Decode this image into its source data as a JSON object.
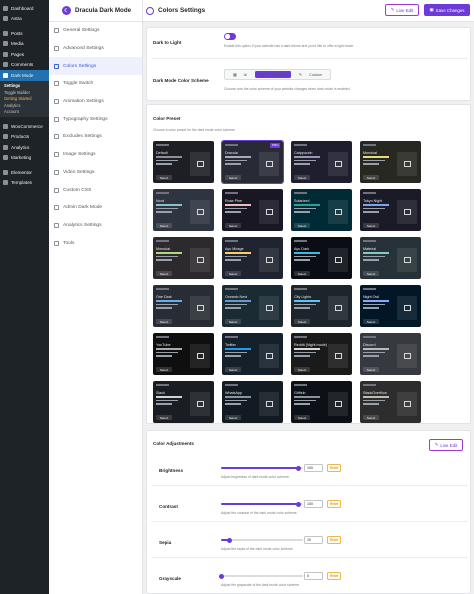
{
  "wp_menu": {
    "items_top": [
      {
        "label": "Dashboard",
        "icon": "dashboard-icon"
      },
      {
        "label": "Astra",
        "icon": "astra-icon"
      }
    ],
    "items_mid": [
      {
        "label": "Posts",
        "icon": "pin-icon"
      },
      {
        "label": "Media",
        "icon": "media-icon"
      },
      {
        "label": "Pages",
        "icon": "page-icon"
      },
      {
        "label": "Comments",
        "icon": "comment-icon"
      }
    ],
    "dark_mode": {
      "label": "Dark Mode",
      "icon": "moon-icon"
    },
    "submenu": [
      "Settings",
      "Toggle Builder",
      "Getting Started",
      "Analytics",
      "Account"
    ],
    "items_bottom": [
      {
        "label": "WooCommerce",
        "icon": "woo-icon"
      },
      {
        "label": "Products",
        "icon": "products-icon"
      },
      {
        "label": "Analytics",
        "icon": "analytics-icon"
      },
      {
        "label": "Marketing",
        "icon": "marketing-icon"
      }
    ],
    "items_last": [
      {
        "label": "Elementor",
        "icon": "elementor-icon"
      },
      {
        "label": "Templates",
        "icon": "templates-icon"
      }
    ]
  },
  "plugin": {
    "brand": "Dracula Dark Mode",
    "nav": [
      "General Settings",
      "Advanced Settings",
      "Colors Settings",
      "Toggle Switch",
      "Animation Settings",
      "Typography Settings",
      "Excludes Settings",
      "Image Settings",
      "Video Settings",
      "Custom CSS",
      "Admin Dark Mode",
      "Analytics Settings",
      "Tools"
    ],
    "active_nav": "Colors Settings"
  },
  "header": {
    "title": "Colors Settings",
    "live_edit": "Live Edit",
    "save": "Save Changes"
  },
  "settings": {
    "dark_to_light": {
      "label": "Dark to Light",
      "enabled": true,
      "desc": "Enable this option if your website has a dark theme and you'd like to offer a light mode."
    },
    "color_scheme": {
      "label": "Dark Mode Color Scheme",
      "options": [
        "AI",
        "Presets",
        "Custom"
      ],
      "selected": "Presets",
      "desc": "Choose how the color scheme of your website changes when dark mode is enabled."
    }
  },
  "color_preset": {
    "title": "Color Preset",
    "desc": "Choose a color preset for the dark mode color scheme.",
    "select_label": "Select",
    "pro_label": "PRO",
    "presets": [
      {
        "name": "Default",
        "bg": "#1e1f25",
        "bar": "#8a8f99"
      },
      {
        "name": "Dracula",
        "bg": "#282a36",
        "bar": "#a9abbd",
        "selected": true,
        "pro": true
      },
      {
        "name": "Catppuccin",
        "bg": "#1e1e2e",
        "bar": "#9399b2"
      },
      {
        "name": "Monokai",
        "bg": "#272822",
        "bar": "#e6db74"
      },
      {
        "name": "Nord",
        "bg": "#2e3440",
        "bar": "#88c0d0"
      },
      {
        "name": "Rose Pine",
        "bg": "#191724",
        "bar": "#ebbcba"
      },
      {
        "name": "Solarized",
        "bg": "#002b36",
        "bar": "#2aa198"
      },
      {
        "name": "Tokyo Night",
        "bg": "#1a1b26",
        "bar": "#7aa2f7"
      },
      {
        "name": "Monokai",
        "bg": "#2d2a2e",
        "bar": "#a9dc76"
      },
      {
        "name": "Ayu Mirage",
        "bg": "#1f2430",
        "bar": "#ffcc66"
      },
      {
        "name": "Ayu Dark",
        "bg": "#0a0e14",
        "bar": "#39bae6"
      },
      {
        "name": "Material",
        "bg": "#263238",
        "bar": "#80cbc4"
      },
      {
        "name": "One Dark",
        "bg": "#282c34",
        "bar": "#61afef"
      },
      {
        "name": "Oceanic Next",
        "bg": "#1b2b34",
        "bar": "#6699cc"
      },
      {
        "name": "City Lights",
        "bg": "#1d252c",
        "bar": "#5ec4ff"
      },
      {
        "name": "Night Owl",
        "bg": "#011627",
        "bar": "#82aaff"
      },
      {
        "name": "YouTube",
        "bg": "#0f0f0f",
        "bar": "#aaaaaa"
      },
      {
        "name": "Twitter",
        "bg": "#15202b",
        "bar": "#1d9bf0"
      },
      {
        "name": "Reddit (Night mode)",
        "bg": "#1a1a1b",
        "bar": "#d7dadc"
      },
      {
        "name": "Discord",
        "bg": "#36393f",
        "bar": "#b9bbbe"
      },
      {
        "name": "Slack",
        "bg": "#1a1d21",
        "bar": "#d1d2d3"
      },
      {
        "name": "WhatsApp",
        "bg": "#111b21",
        "bar": "#8696a0"
      },
      {
        "name": "GitHub",
        "bg": "#0d1117",
        "bar": "#8b949e"
      },
      {
        "name": "StackOverflow",
        "bg": "#2d2d2d",
        "bar": "#bbbbbb"
      }
    ]
  },
  "color_adjustments": {
    "title": "Color Adjustments",
    "live_edit": "Live Edit",
    "reset_label": "Reset",
    "items": [
      {
        "label": "Brightness",
        "value": "100",
        "fill": 0.95,
        "desc": "Adjust brightness of dark mode color scheme."
      },
      {
        "label": "Contrast",
        "value": "100",
        "fill": 0.95,
        "desc": "Adjust the contrast of the dark mode color scheme."
      },
      {
        "label": "Sepia",
        "value": "10",
        "fill": 0.1,
        "desc": "Adjust the sepia of the dark mode color scheme."
      },
      {
        "label": "Grayscale",
        "value": "0",
        "fill": 0.0,
        "desc": "Adjust the grayscale of the dark mode color scheme."
      }
    ]
  },
  "colors": {
    "accent": "#6c3ad6",
    "wp_sidebar": "#1d2327",
    "wp_active": "#2271b1"
  }
}
